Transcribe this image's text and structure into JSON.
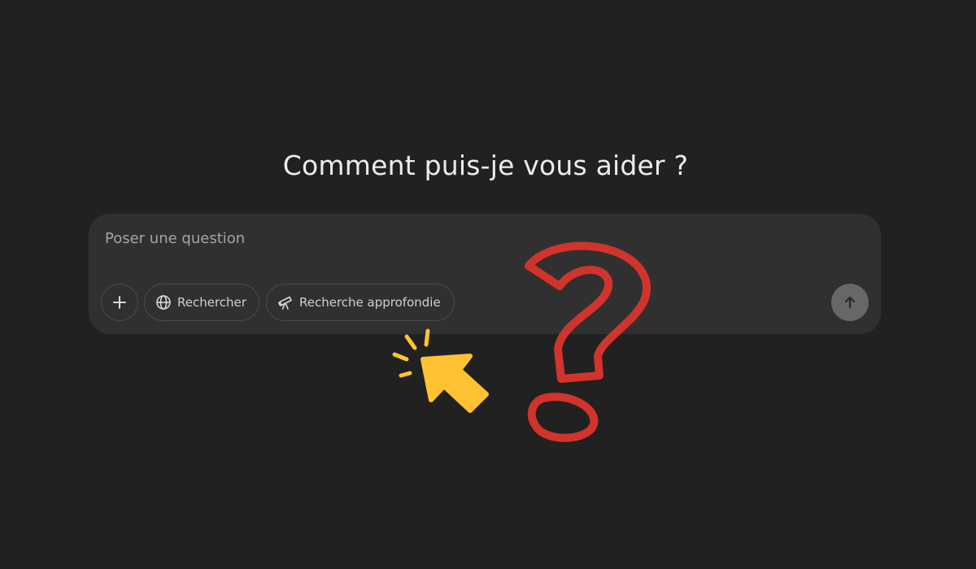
{
  "heading": "Comment puis-je vous aider ?",
  "composer": {
    "placeholder": "Poser une question",
    "value": ""
  },
  "tools": {
    "attach_icon": "plus-icon",
    "search_label": "Rechercher",
    "search_icon": "globe-icon",
    "deep_research_label": "Recherche approfondie",
    "deep_research_icon": "telescope-icon",
    "send_icon": "arrow-up-icon"
  },
  "decorations": {
    "question_mark_color": "#d0342c",
    "pointer_color": "#ffc233"
  },
  "colors": {
    "background": "#212121",
    "composer": "#303030",
    "send_button": "#676767"
  }
}
